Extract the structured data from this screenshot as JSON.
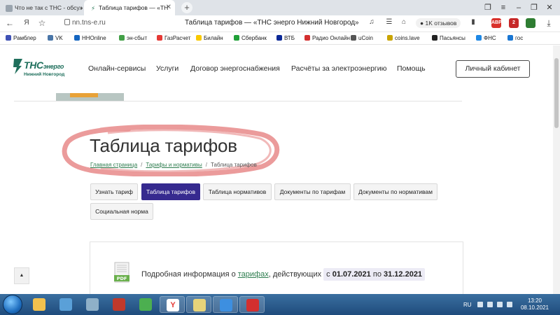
{
  "browser": {
    "tabs": [
      {
        "title": "Что не так с ТНС - обсуж"
      },
      {
        "title": "Таблица тарифов — «ТН"
      }
    ],
    "url": "nn.tns-e.ru",
    "page_title": "Таблица тарифов — «ТНС энерго Нижний Новгород»",
    "reviews_badge": "1K отзывов",
    "extensions": [
      {
        "name": "abp-icon",
        "label": "ABP",
        "color": "#d9312b"
      },
      {
        "name": "badge-icon",
        "label": "2",
        "color": "#c62828"
      },
      {
        "name": "shield-icon",
        "label": "",
        "color": "#2e7d32"
      },
      {
        "name": "game-icon",
        "label": "",
        "color": "#5c6bc0"
      }
    ],
    "bookmarks": [
      {
        "label": "Рамблер",
        "color": "#3f51b5"
      },
      {
        "label": "VK",
        "color": "#4a76a8"
      },
      {
        "label": "HHOnline",
        "color": "#1565c0"
      },
      {
        "label": "эн-сбыт",
        "color": "#43a047"
      },
      {
        "label": "ГазРасчет",
        "color": "#e53935"
      },
      {
        "label": "Билайн",
        "color": "#f9c900"
      },
      {
        "label": "Сбербанк",
        "color": "#21a038"
      },
      {
        "label": "ВТБ",
        "color": "#0a2896"
      },
      {
        "label": "Радио Онлайн",
        "color": "#d32f2f"
      },
      {
        "label": "uCoin",
        "color": "#555555"
      },
      {
        "label": "coins.lave",
        "color": "#c9a400"
      },
      {
        "label": "Пасьянсы",
        "color": "#222222"
      },
      {
        "label": "ФНС",
        "color": "#1e88e5"
      },
      {
        "label": "гос",
        "color": "#1976d2"
      }
    ]
  },
  "site": {
    "logo": {
      "brand": "ТНС",
      "brand_suffix": "энерго",
      "region": "Нижний Новгород",
      "color": "#1f6f5c"
    },
    "nav": [
      {
        "label": "Онлайн-сервисы"
      },
      {
        "label": "Услуги"
      },
      {
        "label": "Договор энергоснабжения"
      },
      {
        "label": "Расчёты за электроэнергию"
      },
      {
        "label": "Помощь"
      }
    ],
    "cabinet_label": "Личный кабинет",
    "title": "Таблица тарифов",
    "breadcrumb": [
      {
        "label": "Главная страница"
      },
      {
        "label": "Тарифы и нормативы"
      },
      {
        "label": "Таблица тарифов"
      }
    ],
    "tabs": [
      {
        "label": "Узнать тариф",
        "active": false
      },
      {
        "label": "Таблица тарифов",
        "active": true
      },
      {
        "label": "Таблица нормативов",
        "active": false
      },
      {
        "label": "Документы по тарифам",
        "active": false
      },
      {
        "label": "Документы по нормативам",
        "active": false
      },
      {
        "label": "Социальная норма",
        "active": false
      }
    ],
    "info": {
      "prefix": "Подробная информация о ",
      "link": "тарифах",
      "middle": ", действующих ",
      "from_word": "с",
      "from_date": "01.07.2021",
      "to_word": "по",
      "to_date": "31.12.2021"
    },
    "accent_color": "#362a8f"
  },
  "taskbar": {
    "language": "RU",
    "time": "13:20",
    "date": "08.10.2021",
    "apps": [
      {
        "name": "explorer-icon",
        "color": "#f2c14e"
      },
      {
        "name": "media-icon",
        "color": "#5aa0d8"
      },
      {
        "name": "calculator-icon",
        "color": "#8fb0c8"
      },
      {
        "name": "archive-icon",
        "color": "#c0392b"
      },
      {
        "name": "photo-icon",
        "color": "#4caf50"
      },
      {
        "name": "yandex-browser-icon",
        "color": "#ffffff",
        "glyph": "Y"
      },
      {
        "name": "folder-icon",
        "color": "#e6d37a"
      },
      {
        "name": "network-icon",
        "color": "#3d8fe0"
      },
      {
        "name": "pdf-reader-icon",
        "color": "#d32f2f"
      }
    ]
  }
}
